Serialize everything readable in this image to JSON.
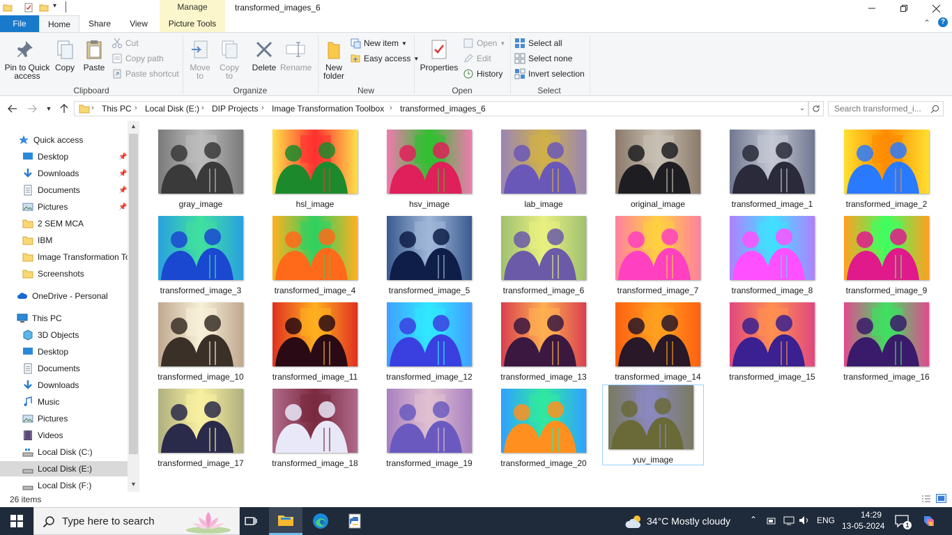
{
  "window": {
    "title": "transformed_images_6",
    "context_tab": "Manage",
    "buttons": [
      "minimize",
      "restore",
      "close"
    ]
  },
  "ribbon_tabs": {
    "file": "File",
    "home": "Home",
    "share": "Share",
    "view": "View",
    "picture_tools": "Picture Tools"
  },
  "ribbon": {
    "clipboard": {
      "label": "Clipboard",
      "pin": "Pin to Quick access",
      "copy": "Copy",
      "paste": "Paste",
      "cut": "Cut",
      "copy_path": "Copy path",
      "paste_shortcut": "Paste shortcut"
    },
    "organize": {
      "label": "Organize",
      "move_to": "Move to",
      "copy_to": "Copy to",
      "delete": "Delete",
      "rename": "Rename"
    },
    "new": {
      "label": "New",
      "new_folder": "New folder",
      "new_item": "New item",
      "easy_access": "Easy access"
    },
    "open": {
      "label": "Open",
      "properties": "Properties",
      "open": "Open",
      "edit": "Edit",
      "history": "History"
    },
    "select": {
      "label": "Select",
      "select_all": "Select all",
      "select_none": "Select none",
      "invert_selection": "Invert selection"
    }
  },
  "address": {
    "breadcrumbs": [
      "This PC",
      "Local Disk (E:)",
      "DIP Projects",
      "Image Transformation Toolbox",
      "transformed_images_6"
    ],
    "search_placeholder": "Search transformed_i..."
  },
  "nav_pane": {
    "quick_access": "Quick access",
    "quick_items": [
      "Desktop",
      "Downloads",
      "Documents",
      "Pictures",
      "2 SEM MCA",
      "IBM",
      "Image Transformation To",
      "Screenshots"
    ],
    "onedrive": "OneDrive - Personal",
    "this_pc": "This PC",
    "pc_items": [
      "3D Objects",
      "Desktop",
      "Documents",
      "Downloads",
      "Music",
      "Pictures",
      "Videos",
      "Local Disk (C:)",
      "Local Disk (E:)",
      "Local Disk (F:)"
    ]
  },
  "files": [
    {
      "name": "gray_image",
      "colors": [
        "#3a3a3a",
        "#bdbdbd",
        "#7a7a7a"
      ]
    },
    {
      "name": "hsl_image",
      "colors": [
        "#1c8a2c",
        "#ff3030",
        "#ffe04a"
      ]
    },
    {
      "name": "hsv_image",
      "colors": [
        "#e0205a",
        "#30c030",
        "#f07ab0"
      ]
    },
    {
      "name": "lab_image",
      "colors": [
        "#6a58b8",
        "#d0b048",
        "#9a86b6"
      ]
    },
    {
      "name": "original_image",
      "colors": [
        "#1e1e22",
        "#c8c0b4",
        "#8a7a6a"
      ]
    },
    {
      "name": "transformed_image_1",
      "colors": [
        "#2a2a3a",
        "#c4c8d4",
        "#707890"
      ]
    },
    {
      "name": "transformed_image_2",
      "colors": [
        "#2a7aff",
        "#ff8a00",
        "#ffe030"
      ]
    },
    {
      "name": "transformed_image_3",
      "colors": [
        "#1a48d0",
        "#40e0a0",
        "#2aa0e0"
      ]
    },
    {
      "name": "transformed_image_4",
      "colors": [
        "#ff6a1a",
        "#30d060",
        "#ffb020"
      ]
    },
    {
      "name": "transformed_image_5",
      "colors": [
        "#0e1e48",
        "#a0b8d8",
        "#3a5a90"
      ]
    },
    {
      "name": "transformed_image_6",
      "colors": [
        "#6a5aa8",
        "#e8f080",
        "#a0c070"
      ]
    },
    {
      "name": "transformed_image_7",
      "colors": [
        "#ff40c0",
        "#ffd040",
        "#ff80a0"
      ]
    },
    {
      "name": "transformed_image_8",
      "colors": [
        "#ff50ff",
        "#40e0ff",
        "#b080ff"
      ]
    },
    {
      "name": "transformed_image_9",
      "colors": [
        "#e01a8a",
        "#40ff60",
        "#ffa020"
      ]
    },
    {
      "name": "transformed_image_10",
      "colors": [
        "#3a3028",
        "#f8f0d8",
        "#c0a890"
      ]
    },
    {
      "name": "transformed_image_11",
      "colors": [
        "#2a0a14",
        "#ffb020",
        "#e03020"
      ]
    },
    {
      "name": "transformed_image_12",
      "colors": [
        "#3a40e0",
        "#30e8ff",
        "#40a0ff"
      ]
    },
    {
      "name": "transformed_image_13",
      "colors": [
        "#3a1840",
        "#ffb050",
        "#d84050"
      ]
    },
    {
      "name": "transformed_image_14",
      "colors": [
        "#281828",
        "#ffa020",
        "#ff6010"
      ]
    },
    {
      "name": "transformed_image_15",
      "colors": [
        "#3a2090",
        "#ff9050",
        "#e04880"
      ]
    },
    {
      "name": "transformed_image_16",
      "colors": [
        "#3a1a6a",
        "#40e060",
        "#e04a90"
      ]
    },
    {
      "name": "transformed_image_17",
      "colors": [
        "#2a2a4a",
        "#f8f0a0",
        "#b0b080"
      ]
    },
    {
      "name": "transformed_image_18",
      "colors": [
        "#e8e8f8",
        "#7a2a40",
        "#b06a8a"
      ]
    },
    {
      "name": "transformed_image_19",
      "colors": [
        "#6a5ac0",
        "#e0c0d0",
        "#a880c0"
      ]
    },
    {
      "name": "transformed_image_20",
      "colors": [
        "#ff9020",
        "#30e8a0",
        "#30a0ff"
      ]
    },
    {
      "name": "yuv_image",
      "colors": [
        "#6a6a38",
        "#8a88c0",
        "#7a7a60"
      ]
    }
  ],
  "status": {
    "item_count": "26 items"
  },
  "taskbar": {
    "search_placeholder": "Type here to search",
    "weather": "34°C  Mostly cloudy",
    "language": "ENG",
    "time": "14:29",
    "date": "13-05-2024",
    "notification_count": "1"
  },
  "colors": {
    "accent": "#1979ca",
    "selection": "#cce8ff",
    "manage_bg": "#fcf6cc",
    "taskbar": "#1f2a3a"
  }
}
